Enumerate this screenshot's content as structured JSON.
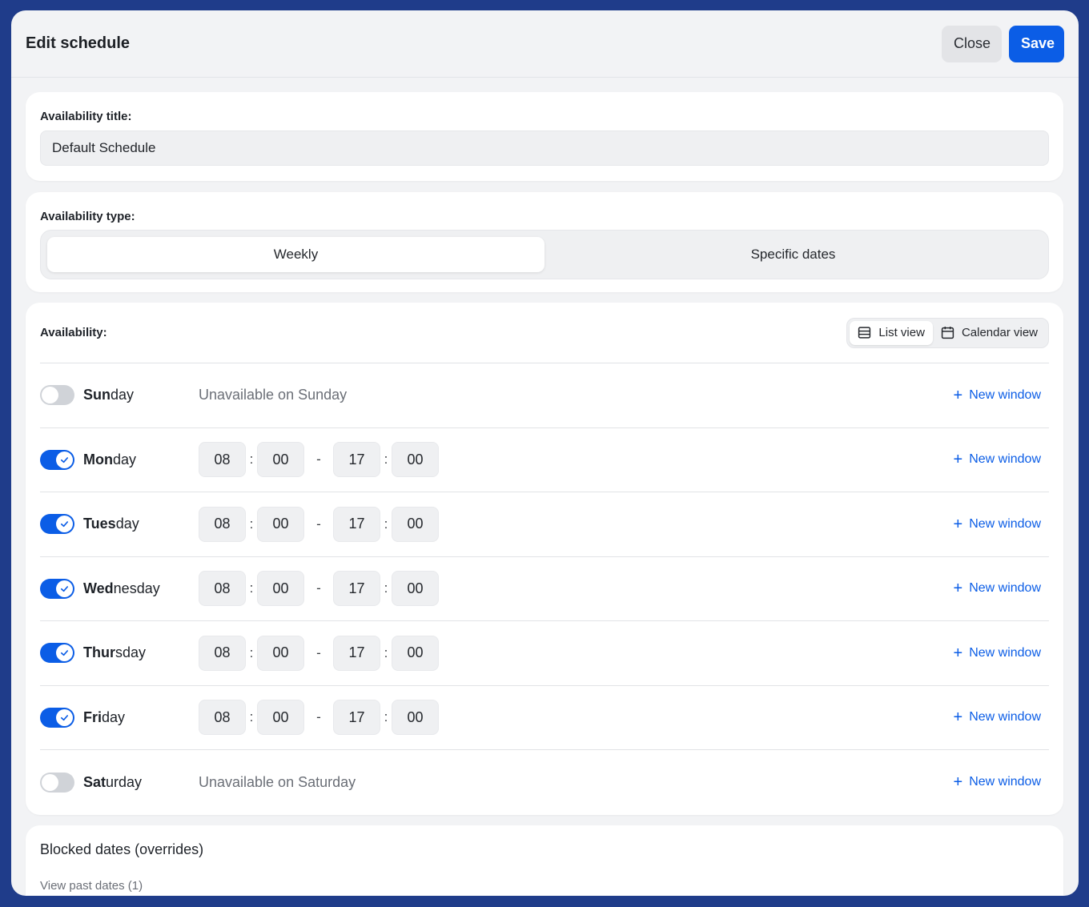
{
  "header": {
    "title": "Edit schedule",
    "close_label": "Close",
    "save_label": "Save"
  },
  "availability_title": {
    "label": "Availability title:",
    "value": "Default Schedule"
  },
  "availability_type": {
    "label": "Availability type:",
    "options": [
      "Weekly",
      "Specific dates"
    ],
    "selected": "Weekly"
  },
  "availability": {
    "label": "Availability:",
    "views": [
      "List view",
      "Calendar view"
    ],
    "selected_view": "List view",
    "new_window_label": "New window",
    "days": [
      {
        "bold": "Sun",
        "rest": "day",
        "enabled": false,
        "unavailable_text": "Unavailable on Sunday"
      },
      {
        "bold": "Mon",
        "rest": "day",
        "enabled": true,
        "start_h": "08",
        "start_m": "00",
        "end_h": "17",
        "end_m": "00"
      },
      {
        "bold": "Tues",
        "rest": "day",
        "enabled": true,
        "start_h": "08",
        "start_m": "00",
        "end_h": "17",
        "end_m": "00"
      },
      {
        "bold": "Wed",
        "rest": "nesday",
        "enabled": true,
        "start_h": "08",
        "start_m": "00",
        "end_h": "17",
        "end_m": "00"
      },
      {
        "bold": "Thur",
        "rest": "sday",
        "enabled": true,
        "start_h": "08",
        "start_m": "00",
        "end_h": "17",
        "end_m": "00"
      },
      {
        "bold": "Fri",
        "rest": "day",
        "enabled": true,
        "start_h": "08",
        "start_m": "00",
        "end_h": "17",
        "end_m": "00"
      },
      {
        "bold": "Sat",
        "rest": "urday",
        "enabled": false,
        "unavailable_text": "Unavailable on Saturday"
      }
    ]
  },
  "blocked_dates": {
    "title": "Blocked dates (overrides)",
    "past_link": "View past dates (1)"
  },
  "colors": {
    "accent": "#0b5de6",
    "toggle_off": "#d0d3d8"
  }
}
